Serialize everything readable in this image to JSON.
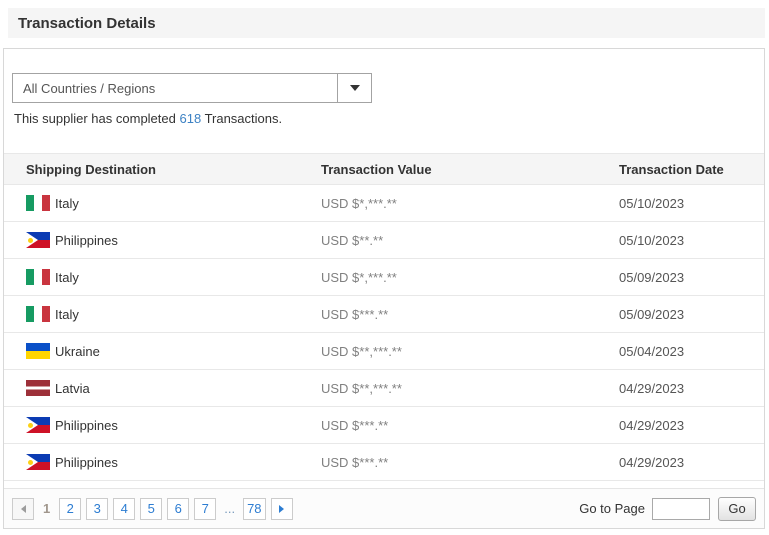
{
  "page": {
    "title": "Transaction Details"
  },
  "filter": {
    "selected": "All Countries / Regions"
  },
  "summary": {
    "prefix": "This supplier has completed ",
    "count": "618",
    "suffix": " Transactions."
  },
  "table": {
    "columns": [
      "Shipping Destination",
      "Transaction Value",
      "Transaction Date"
    ],
    "rows": [
      {
        "country": "Italy",
        "flag": "italy",
        "value": "USD $*,***.**",
        "date": "05/10/2023"
      },
      {
        "country": "Philippines",
        "flag": "philippines",
        "value": "USD $**.**",
        "date": "05/10/2023"
      },
      {
        "country": "Italy",
        "flag": "italy",
        "value": "USD $*,***.**",
        "date": "05/09/2023"
      },
      {
        "country": "Italy",
        "flag": "italy",
        "value": "USD $***.**",
        "date": "05/09/2023"
      },
      {
        "country": "Ukraine",
        "flag": "ukraine",
        "value": "USD $**,***.**",
        "date": "05/04/2023"
      },
      {
        "country": "Latvia",
        "flag": "latvia",
        "value": "USD $**,***.**",
        "date": "04/29/2023"
      },
      {
        "country": "Philippines",
        "flag": "philippines",
        "value": "USD $***.**",
        "date": "04/29/2023"
      },
      {
        "country": "Philippines",
        "flag": "philippines",
        "value": "USD $***.**",
        "date": "04/29/2023"
      }
    ]
  },
  "pagination": {
    "current": "1",
    "pages": [
      "1",
      "2",
      "3",
      "4",
      "5",
      "6",
      "7",
      "...",
      "78"
    ],
    "goto_label": "Go to Page",
    "goto_value": "",
    "go_button": "Go"
  },
  "colors": {
    "title_bar_bg": "#f5f5f5",
    "table_header_bg": "#f5f5f5",
    "link_blue": "#3d82c4",
    "pagination_blue": "#2d7dd2"
  }
}
